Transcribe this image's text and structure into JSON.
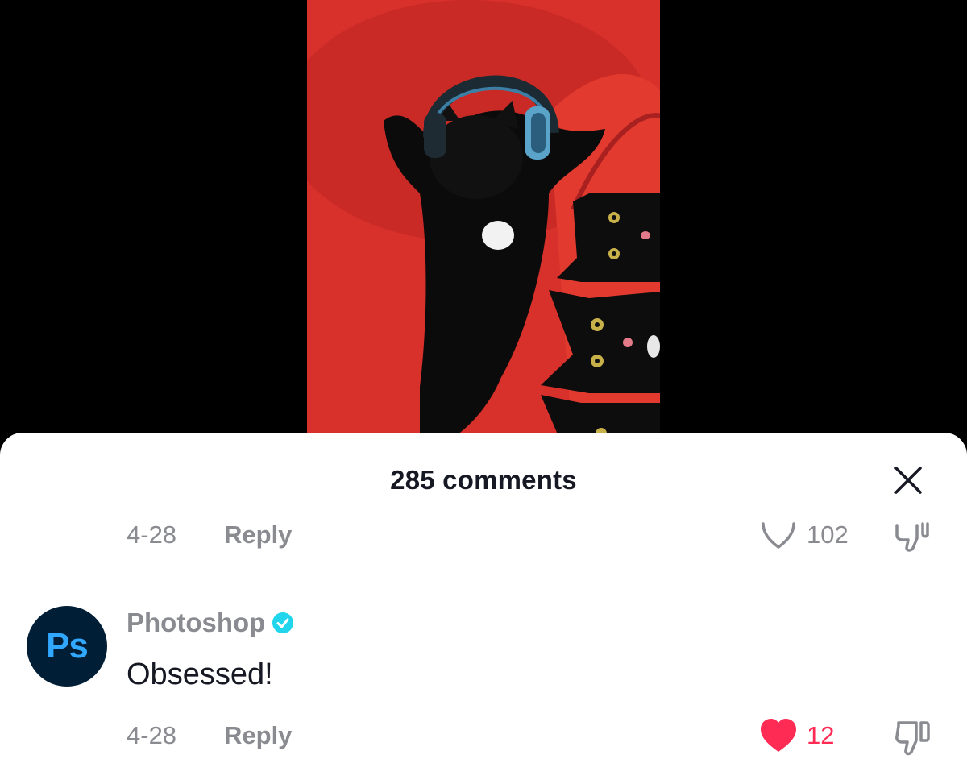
{
  "sheet": {
    "title": "285 comments"
  },
  "previous_comment": {
    "date": "4-28",
    "reply_label": "Reply",
    "like_count": "102"
  },
  "comment": {
    "avatar_text": "Ps",
    "username": "Photoshop",
    "verified": true,
    "text": "Obsessed!",
    "date": "4-28",
    "reply_label": "Reply",
    "like_count": "12",
    "liked": true
  },
  "colors": {
    "accent_like": "#fe2c55",
    "verified_badge": "#20d5ec",
    "muted_text": "#8a8b91",
    "video_background": "#d63228",
    "avatar_background": "#001e36",
    "avatar_text": "#31a8ff"
  },
  "icons": {
    "close": "close-icon",
    "like_outline": "heart-outline-icon",
    "like_filled": "heart-filled-icon",
    "dislike": "thumbs-down-icon",
    "verified": "verified-check-icon"
  }
}
